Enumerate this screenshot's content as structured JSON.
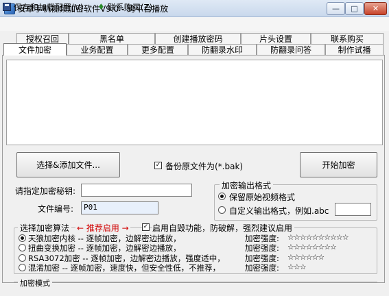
{
  "window": {
    "title": "安卓手机视频加密软件V9.0 - 跨平台播放"
  },
  "menu": {
    "save_load": "保存和加载配置(V)",
    "buy": "联系购买(Z)"
  },
  "tabs": {
    "row1": [
      "授权召回",
      "黑名单",
      "创建播放密码",
      "片头设置",
      "联系购买"
    ],
    "row2": [
      "文件加密",
      "业务配置",
      "更多配置",
      "防翻录水印",
      "防翻录问答",
      "制作试播"
    ]
  },
  "buttons": {
    "select_add": "选择&添加文件...",
    "start": "开始加密"
  },
  "backup": {
    "label": "备份原文件为(*.bak)",
    "checked": true
  },
  "key": {
    "label": "请指定加密秘钥:",
    "value": ""
  },
  "file_no": {
    "label": "文件编号:",
    "value": "P01"
  },
  "output": {
    "title": "加密输出格式",
    "keep_label": "保留原始视频格式",
    "custom_label": "自定义输出格式，例如.abc",
    "custom_value": "",
    "selected": "keep"
  },
  "algorithm": {
    "title": "选择加密算法",
    "hint": "← 推荐启用 →",
    "selfdestruct_label": "启用自毁功能，防破解，强烈建议启用",
    "selfdestruct_checked": true,
    "options": [
      {
        "text": "天狼加密内核 -- 逐帧加密，边解密边播放，",
        "strength_label": "加密强度:",
        "stars": "☆☆☆☆☆☆☆☆☆☆",
        "selected": true
      },
      {
        "text": "扭曲变换加密 -- 逐帧加密，边解密边播放，",
        "strength_label": "加密强度:",
        "stars": "☆☆☆☆☆☆☆☆",
        "selected": false
      },
      {
        "text": "RSA3072加密 -- 逐帧加密，边解密边播放，强度适中，",
        "strength_label": "加密强度:",
        "stars": "☆☆☆☆☆☆",
        "selected": false
      },
      {
        "text": "混淆加密 -- 逐帧加密，速度快，但安全性低，不推荐，",
        "strength_label": "加密强度:",
        "stars": "☆☆☆",
        "selected": false
      }
    ]
  },
  "mode": {
    "title": "加密模式"
  }
}
